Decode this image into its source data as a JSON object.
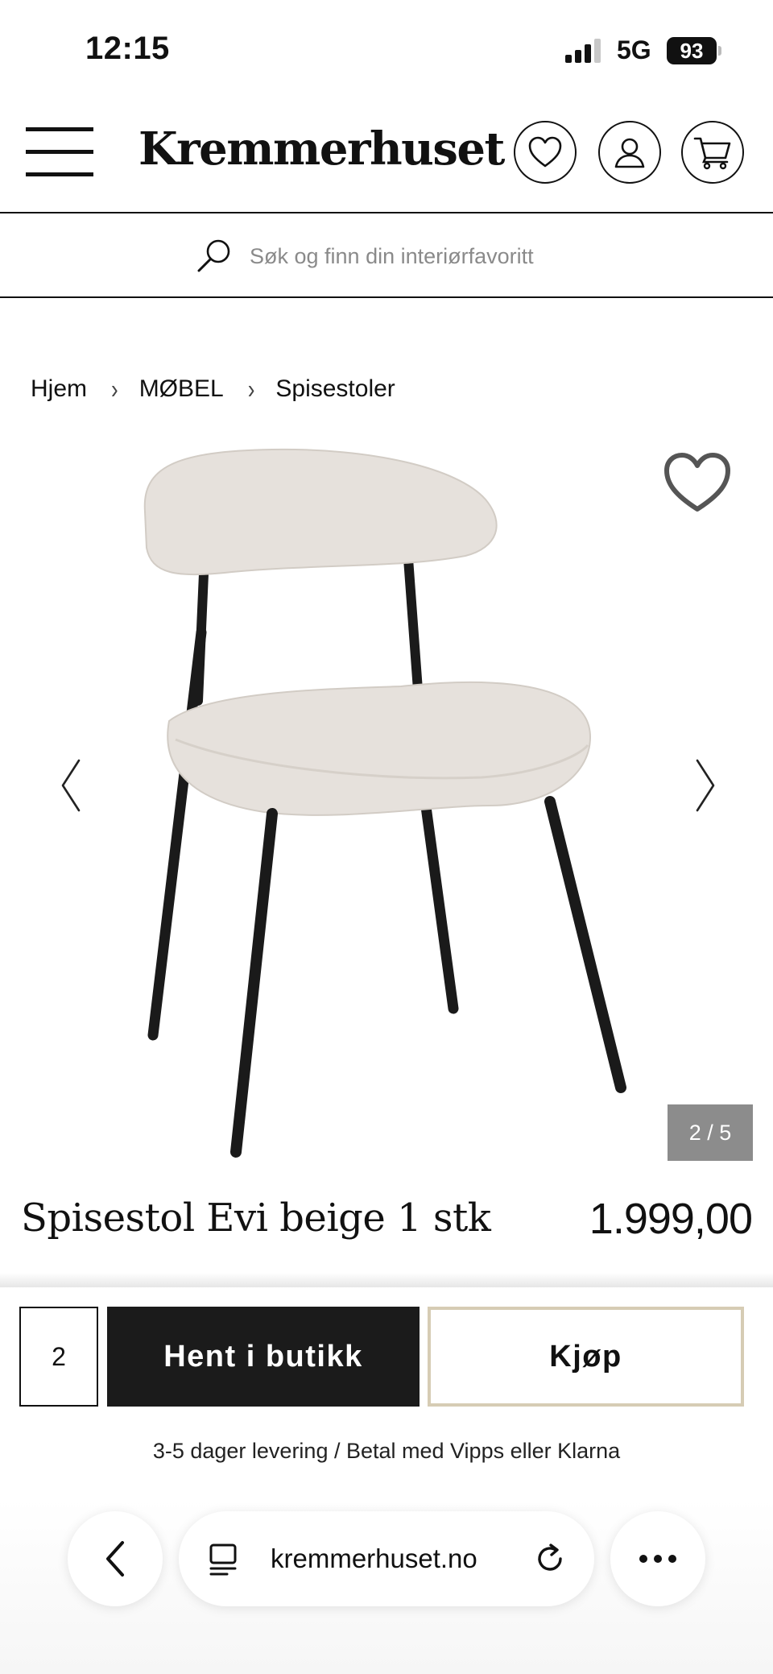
{
  "status_bar": {
    "time": "12:15",
    "network": "5G",
    "battery": "93"
  },
  "header": {
    "logo": "Kremmerhuset",
    "icons": [
      "menu-icon",
      "heart-icon",
      "user-icon",
      "cart-icon"
    ]
  },
  "search": {
    "placeholder": "Søk og finn din interiørfavoritt"
  },
  "breadcrumb": {
    "items": [
      "Hjem",
      "MØBEL",
      "Spisestoler"
    ]
  },
  "gallery": {
    "counter": "2 / 5"
  },
  "product": {
    "title": "Spisestol Evi beige 1 stk",
    "price": "1.999,00"
  },
  "purchase": {
    "quantity": "2",
    "store_button": "Hent i butikk",
    "buy_button": "Kjøp",
    "delivery_info": "3-5 dager levering / Betal med Vipps eller Klarna"
  },
  "browser": {
    "url": "kremmerhuset.no"
  },
  "colors": {
    "text": "#111111",
    "button_dark": "#1b1b1b",
    "buy_border": "#d6ccb4",
    "counter_bg": "#8c8c8c",
    "chair_fabric": "#e6e1dc",
    "chair_frame": "#1a1a1a"
  }
}
